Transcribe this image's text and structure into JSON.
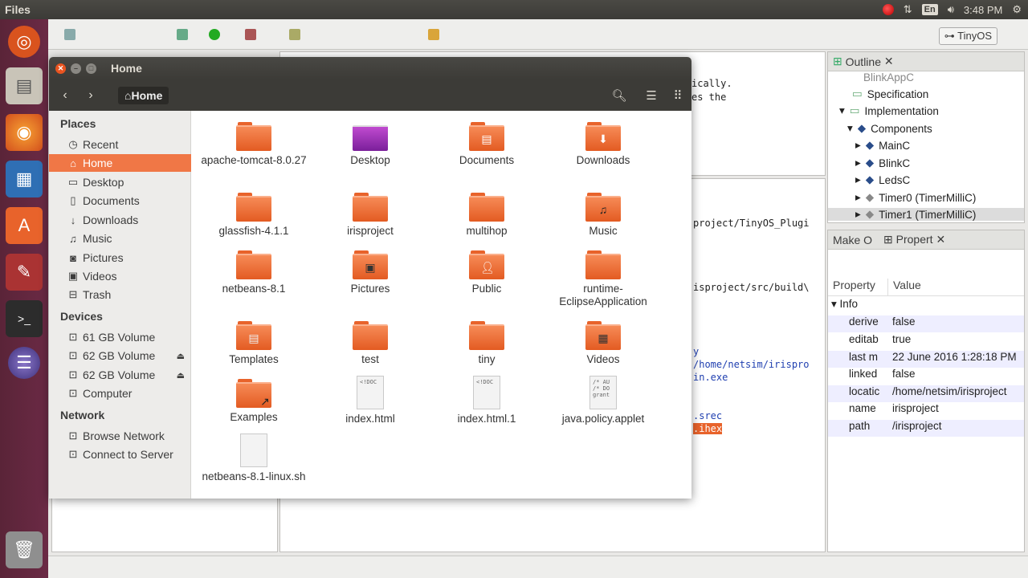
{
  "topbar": {
    "app_name": "Files",
    "lang": "En",
    "time": "3:48 PM"
  },
  "eclipse": {
    "perspective": "TinyOS",
    "editor_snippet": [
      "ically.",
      "es the"
    ],
    "console_lines": [
      "project/TinyOS_Plugi",
      "isproject/src/build\\",
      "y",
      "/home/netsim/irispro",
      "in.exe",
      ".srec",
      ".ihex"
    ],
    "outline": {
      "tab": "Outline",
      "items": [
        "BlinkAppC",
        "Specification",
        "Implementation",
        "Components",
        "MainC",
        "BlinkC",
        "LedsC",
        "Timer0 (TimerMilliC)",
        "Timer1 (TimerMilliC)"
      ]
    },
    "props": {
      "tab_make": "Make O",
      "tab_prop": "Propert",
      "col_property": "Property",
      "col_value": "Value",
      "group": "Info",
      "rows": [
        {
          "k": "derive",
          "v": "false"
        },
        {
          "k": "editab",
          "v": "true"
        },
        {
          "k": "last m",
          "v": "22 June 2016 1:28:18 PM"
        },
        {
          "k": "linked",
          "v": "false"
        },
        {
          "k": "locatic",
          "v": "/home/netsim/irisproject"
        },
        {
          "k": "name",
          "v": "irisproject"
        },
        {
          "k": "path",
          "v": "/irisproject"
        }
      ]
    }
  },
  "files": {
    "window_title": "Home",
    "location": "Home",
    "sidebar": {
      "places_header": "Places",
      "places": [
        "Recent",
        "Home",
        "Desktop",
        "Documents",
        "Downloads",
        "Music",
        "Pictures",
        "Videos",
        "Trash"
      ],
      "devices_header": "Devices",
      "devices": [
        "61 GB Volume",
        "62 GB Volume",
        "62 GB Volume",
        "Computer"
      ],
      "network_header": "Network",
      "network": [
        "Browse Network",
        "Connect to Server"
      ]
    },
    "items": [
      {
        "name": "apache-tomcat-8.0.27",
        "kind": "folder"
      },
      {
        "name": "Desktop",
        "kind": "desktop"
      },
      {
        "name": "Documents",
        "kind": "folder"
      },
      {
        "name": "Downloads",
        "kind": "folder"
      },
      {
        "name": "glassfish-4.1.1",
        "kind": "folder"
      },
      {
        "name": "irisproject",
        "kind": "folder"
      },
      {
        "name": "multihop",
        "kind": "folder"
      },
      {
        "name": "Music",
        "kind": "folder"
      },
      {
        "name": "netbeans-8.1",
        "kind": "folder"
      },
      {
        "name": "Pictures",
        "kind": "folder"
      },
      {
        "name": "Public",
        "kind": "folder"
      },
      {
        "name": "runtime-EclipseApplication",
        "kind": "folder"
      },
      {
        "name": "Templates",
        "kind": "folder"
      },
      {
        "name": "test",
        "kind": "folder"
      },
      {
        "name": "tiny",
        "kind": "folder"
      },
      {
        "name": "Videos",
        "kind": "folder"
      },
      {
        "name": "Examples",
        "kind": "folder"
      },
      {
        "name": "index.html",
        "kind": "doc"
      },
      {
        "name": "index.html.1",
        "kind": "doc"
      },
      {
        "name": "java.policy.applet",
        "kind": "doc"
      },
      {
        "name": "netbeans-8.1-linux.sh",
        "kind": "doc"
      }
    ],
    "doc_header": "<!DOC",
    "policy_text": "/* AU\n/* DO\ngrant"
  }
}
